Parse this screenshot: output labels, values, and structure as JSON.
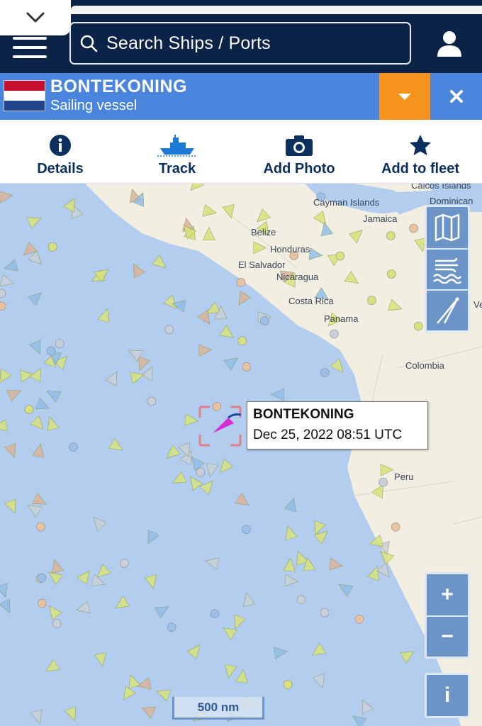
{
  "search": {
    "placeholder": "Search Ships  /  Ports"
  },
  "vessel": {
    "name": "BONTEKONING",
    "type": "Sailing vessel",
    "flag_colors": [
      "#c8102e",
      "#ffffff",
      "#21468b"
    ]
  },
  "actions": [
    {
      "label": "Details",
      "icon": "info-icon"
    },
    {
      "label": "Track",
      "icon": "ship-icon"
    },
    {
      "label": "Add Photo",
      "icon": "camera-icon"
    },
    {
      "label": "Add to fleet",
      "icon": "star-icon"
    }
  ],
  "map": {
    "labels": [
      "Cayman Islands",
      "Caicos Islands",
      "Dominican",
      "Jamaica",
      "Belize",
      "Honduras",
      "El Salvador",
      "Nicaragua",
      "Costa Rica",
      "Panama",
      "Colombia",
      "Peru",
      "Ve"
    ],
    "tooltip": {
      "name": "BONTEKONING",
      "timestamp": "Dec 25, 2022 08:51 UTC"
    },
    "scale_label": "500 nm",
    "controls": {
      "zoom_in": "+",
      "zoom_out": "−",
      "info": "i"
    }
  },
  "colors": {
    "header": "#0b2346",
    "vessel_bar": "#4a85dd",
    "accent": "#f7941d",
    "sea": "#b2cdee",
    "land": "#f3eee2"
  }
}
